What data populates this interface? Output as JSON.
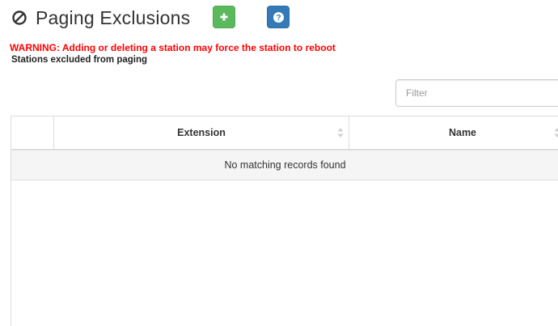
{
  "header": {
    "title": "Paging Exclusions",
    "add_button_icon": "plus-icon",
    "help_button_icon": "question-icon",
    "add_color": "#5cb85c",
    "help_color": "#337ab7"
  },
  "warning": "WARNING: Adding or deleting a station may force the station to reboot",
  "subtitle": "Stations excluded from paging",
  "filter": {
    "placeholder": "Filter",
    "value": ""
  },
  "table": {
    "columns": [
      {
        "label": ""
      },
      {
        "label": "Extension"
      },
      {
        "label": "Name"
      }
    ],
    "empty_message": "No matching records found"
  },
  "colors": {
    "warning": "#ff0000",
    "empty_row_bg": "#f5f5f5"
  }
}
